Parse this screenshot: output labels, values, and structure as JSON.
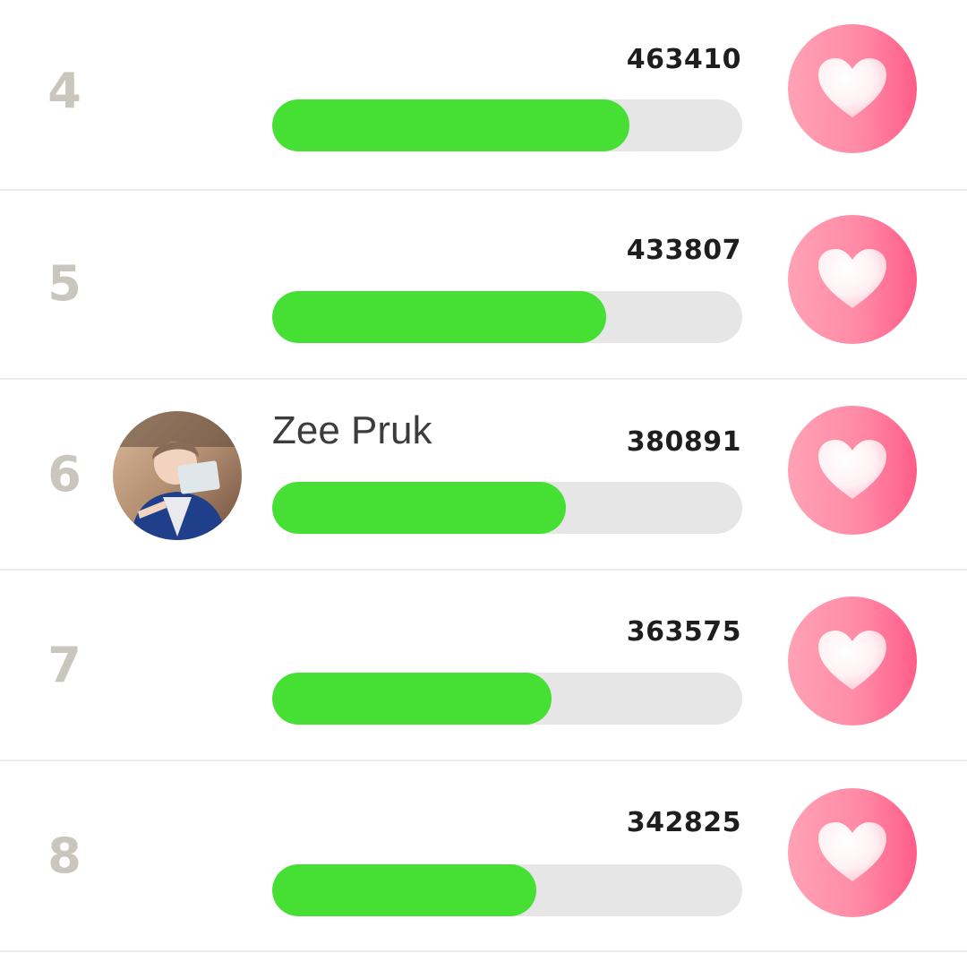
{
  "ranking": {
    "rows": [
      {
        "rank": "4",
        "name": "",
        "votes": "463410",
        "progress": 0.76
      },
      {
        "rank": "5",
        "name": "",
        "votes": "433807",
        "progress": 0.71
      },
      {
        "rank": "6",
        "name": "Zee Pruk",
        "votes": "380891",
        "progress": 0.624
      },
      {
        "rank": "7",
        "name": "",
        "votes": "363575",
        "progress": 0.595
      },
      {
        "rank": "8",
        "name": "",
        "votes": "342825",
        "progress": 0.562
      }
    ]
  },
  "colors": {
    "progress_fill": "#46e034",
    "progress_track": "#e6e6e6",
    "rank_text": "#c9c6bd",
    "heart_button": "#ff7a9a"
  },
  "icons": {
    "vote_button": "heart-icon"
  }
}
